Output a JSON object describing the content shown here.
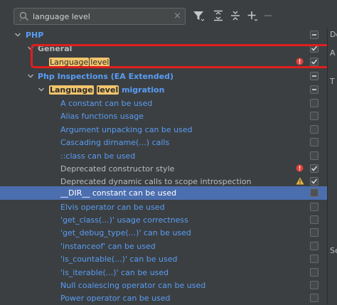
{
  "search": {
    "value": "language level",
    "clear_glyph": "×"
  },
  "toolbar": {
    "icons": [
      "filter-icon",
      "expand-all-icon",
      "collapse-all-icon",
      "add-icon",
      "remove-icon"
    ]
  },
  "colors": {
    "accent_blue": "#589df6",
    "selection": "#4b6eaf",
    "highlight": "#f2c56d",
    "error_red": "#e01e1e",
    "warning": "#e3b341"
  },
  "tree": {
    "php": "PHP",
    "general": "General",
    "language_level_hl": "Language",
    "language_level_hl2": "level",
    "ea_extended": "Php Inspections (EA Extended)",
    "migration_hl1": "Language",
    "migration_hl2": "level",
    "migration_rest": "migration",
    "items": [
      "A constant can be used",
      "Alias functions usage",
      "Argument unpacking can be used",
      "Cascading dirname(...) calls",
      "::class can be used",
      "Deprecated constructor style",
      "Deprecated dynamic calls to scope introspection",
      "__DIR__ constant can be used",
      "Elvis operator can be used",
      "'get_class(...)' usage correctness",
      "'get_debug_type(...)' can be used",
      "'instanceof' can be used",
      "'is_countable(...)' can be used",
      "'is_iterable(...)' can be used",
      "Null coalescing operator can be used",
      "Power operator can be used"
    ]
  },
  "right_pane": {
    "line1": "De",
    "line2": "A",
    "line3": "T",
    "line4": "Se"
  }
}
